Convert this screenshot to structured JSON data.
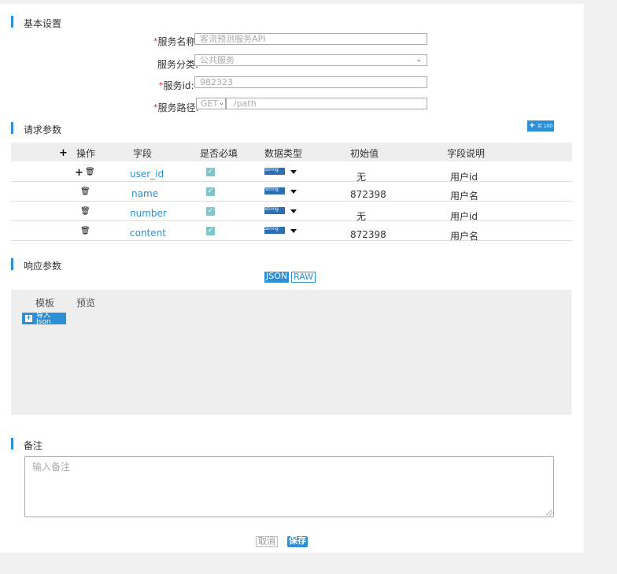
{
  "basic": {
    "title": "基本设置",
    "service_name_label": "服务名称",
    "service_name_value": "客流预测服务API",
    "service_category_label": "服务分类",
    "service_category_value": "公共服务",
    "service_id_label": "服务id",
    "service_id_value": "982323",
    "service_path_label": "服务路径",
    "method_value": "GET",
    "path_value": "/path",
    "required_mark": "*",
    "colon": ":"
  },
  "request": {
    "title": "请求参数",
    "add_row_button_label": "+",
    "add_row_button_text": "另 100",
    "columns": [
      "操作",
      "字段",
      "是否必填",
      "数据类型",
      "初始值",
      "字段说明"
    ],
    "header_plus": "+",
    "rows": [
      {
        "field": "user_id",
        "required": true,
        "type": "String",
        "default": "无",
        "desc": "用户id"
      },
      {
        "field": "name",
        "required": true,
        "type": "String",
        "default": "872398",
        "desc": "用户名"
      },
      {
        "field": "number",
        "required": true,
        "type": "String",
        "default": "无",
        "desc": "用户id"
      },
      {
        "field": "content",
        "required": true,
        "type": "String",
        "default": "872398",
        "desc": "用户名"
      }
    ]
  },
  "response": {
    "title": "响应参数",
    "format_options": [
      "JSON",
      "RAW"
    ],
    "selected_format": "JSON",
    "tabs": [
      "模板",
      "预览"
    ],
    "import_button_label": "导入 Json"
  },
  "notes": {
    "title": "备注",
    "placeholder": "输入备注"
  },
  "footer": {
    "cancel_label": "取消",
    "save_label": "保存"
  },
  "colors": {
    "accent": "#2d8fd5",
    "required": "#e0282e",
    "checkbox": "#7fc5c9"
  }
}
